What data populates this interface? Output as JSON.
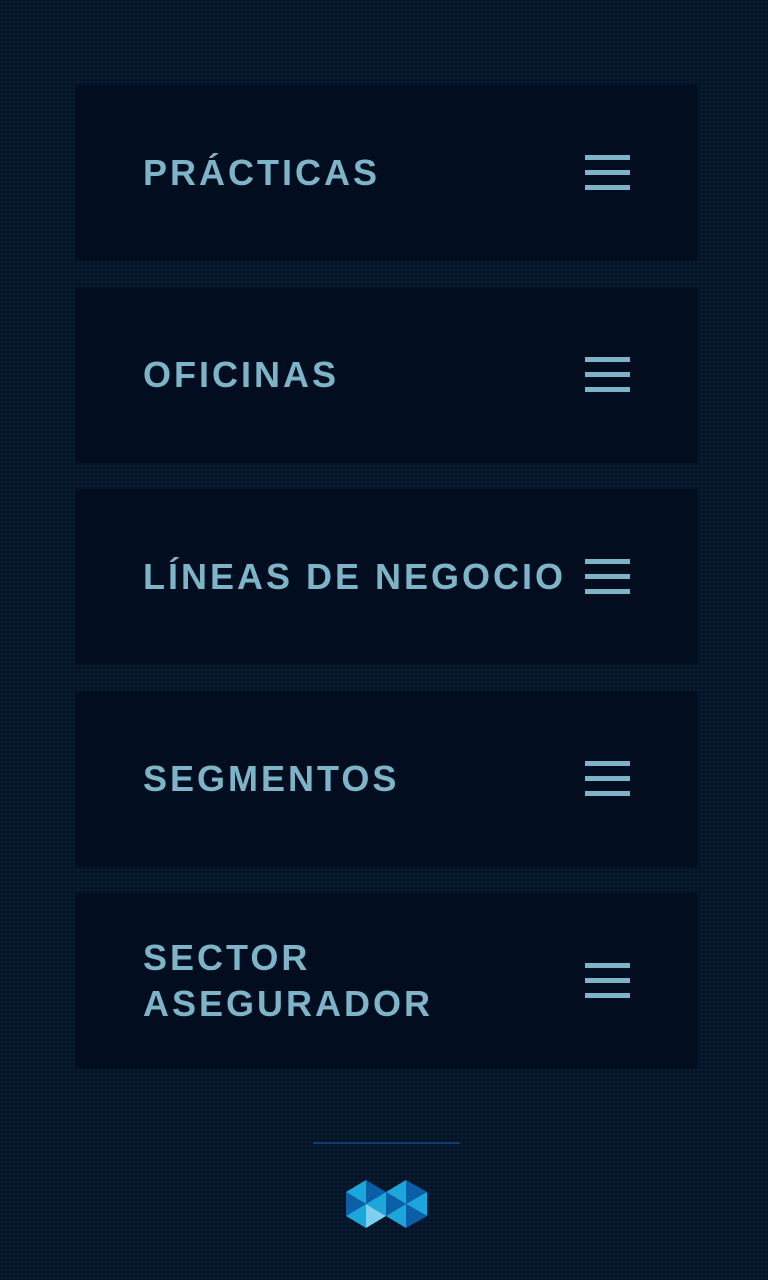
{
  "menu": {
    "items": [
      {
        "label": "PRÁCTICAS",
        "icon": "hamburger-menu-icon"
      },
      {
        "label": "OFICINAS",
        "icon": "hamburger-menu-icon"
      },
      {
        "label": "LÍNEAS DE NEGOCIO",
        "icon": "hamburger-menu-icon"
      },
      {
        "label": "SEGMENTOS",
        "icon": "hamburger-menu-icon"
      },
      {
        "label": "SECTOR\nASEGURADOR",
        "icon": "hamburger-menu-icon"
      }
    ]
  },
  "footer": {
    "logo_icon": "brand-logo-icon"
  },
  "colors": {
    "background": "#04172c",
    "panel": "#020e1f",
    "text": "#7eb4c8",
    "divider": "#0f3c72",
    "logo_light": "#1ba6dc",
    "logo_dark": "#0b5fa8",
    "logo_pale": "#7fd0ee"
  }
}
